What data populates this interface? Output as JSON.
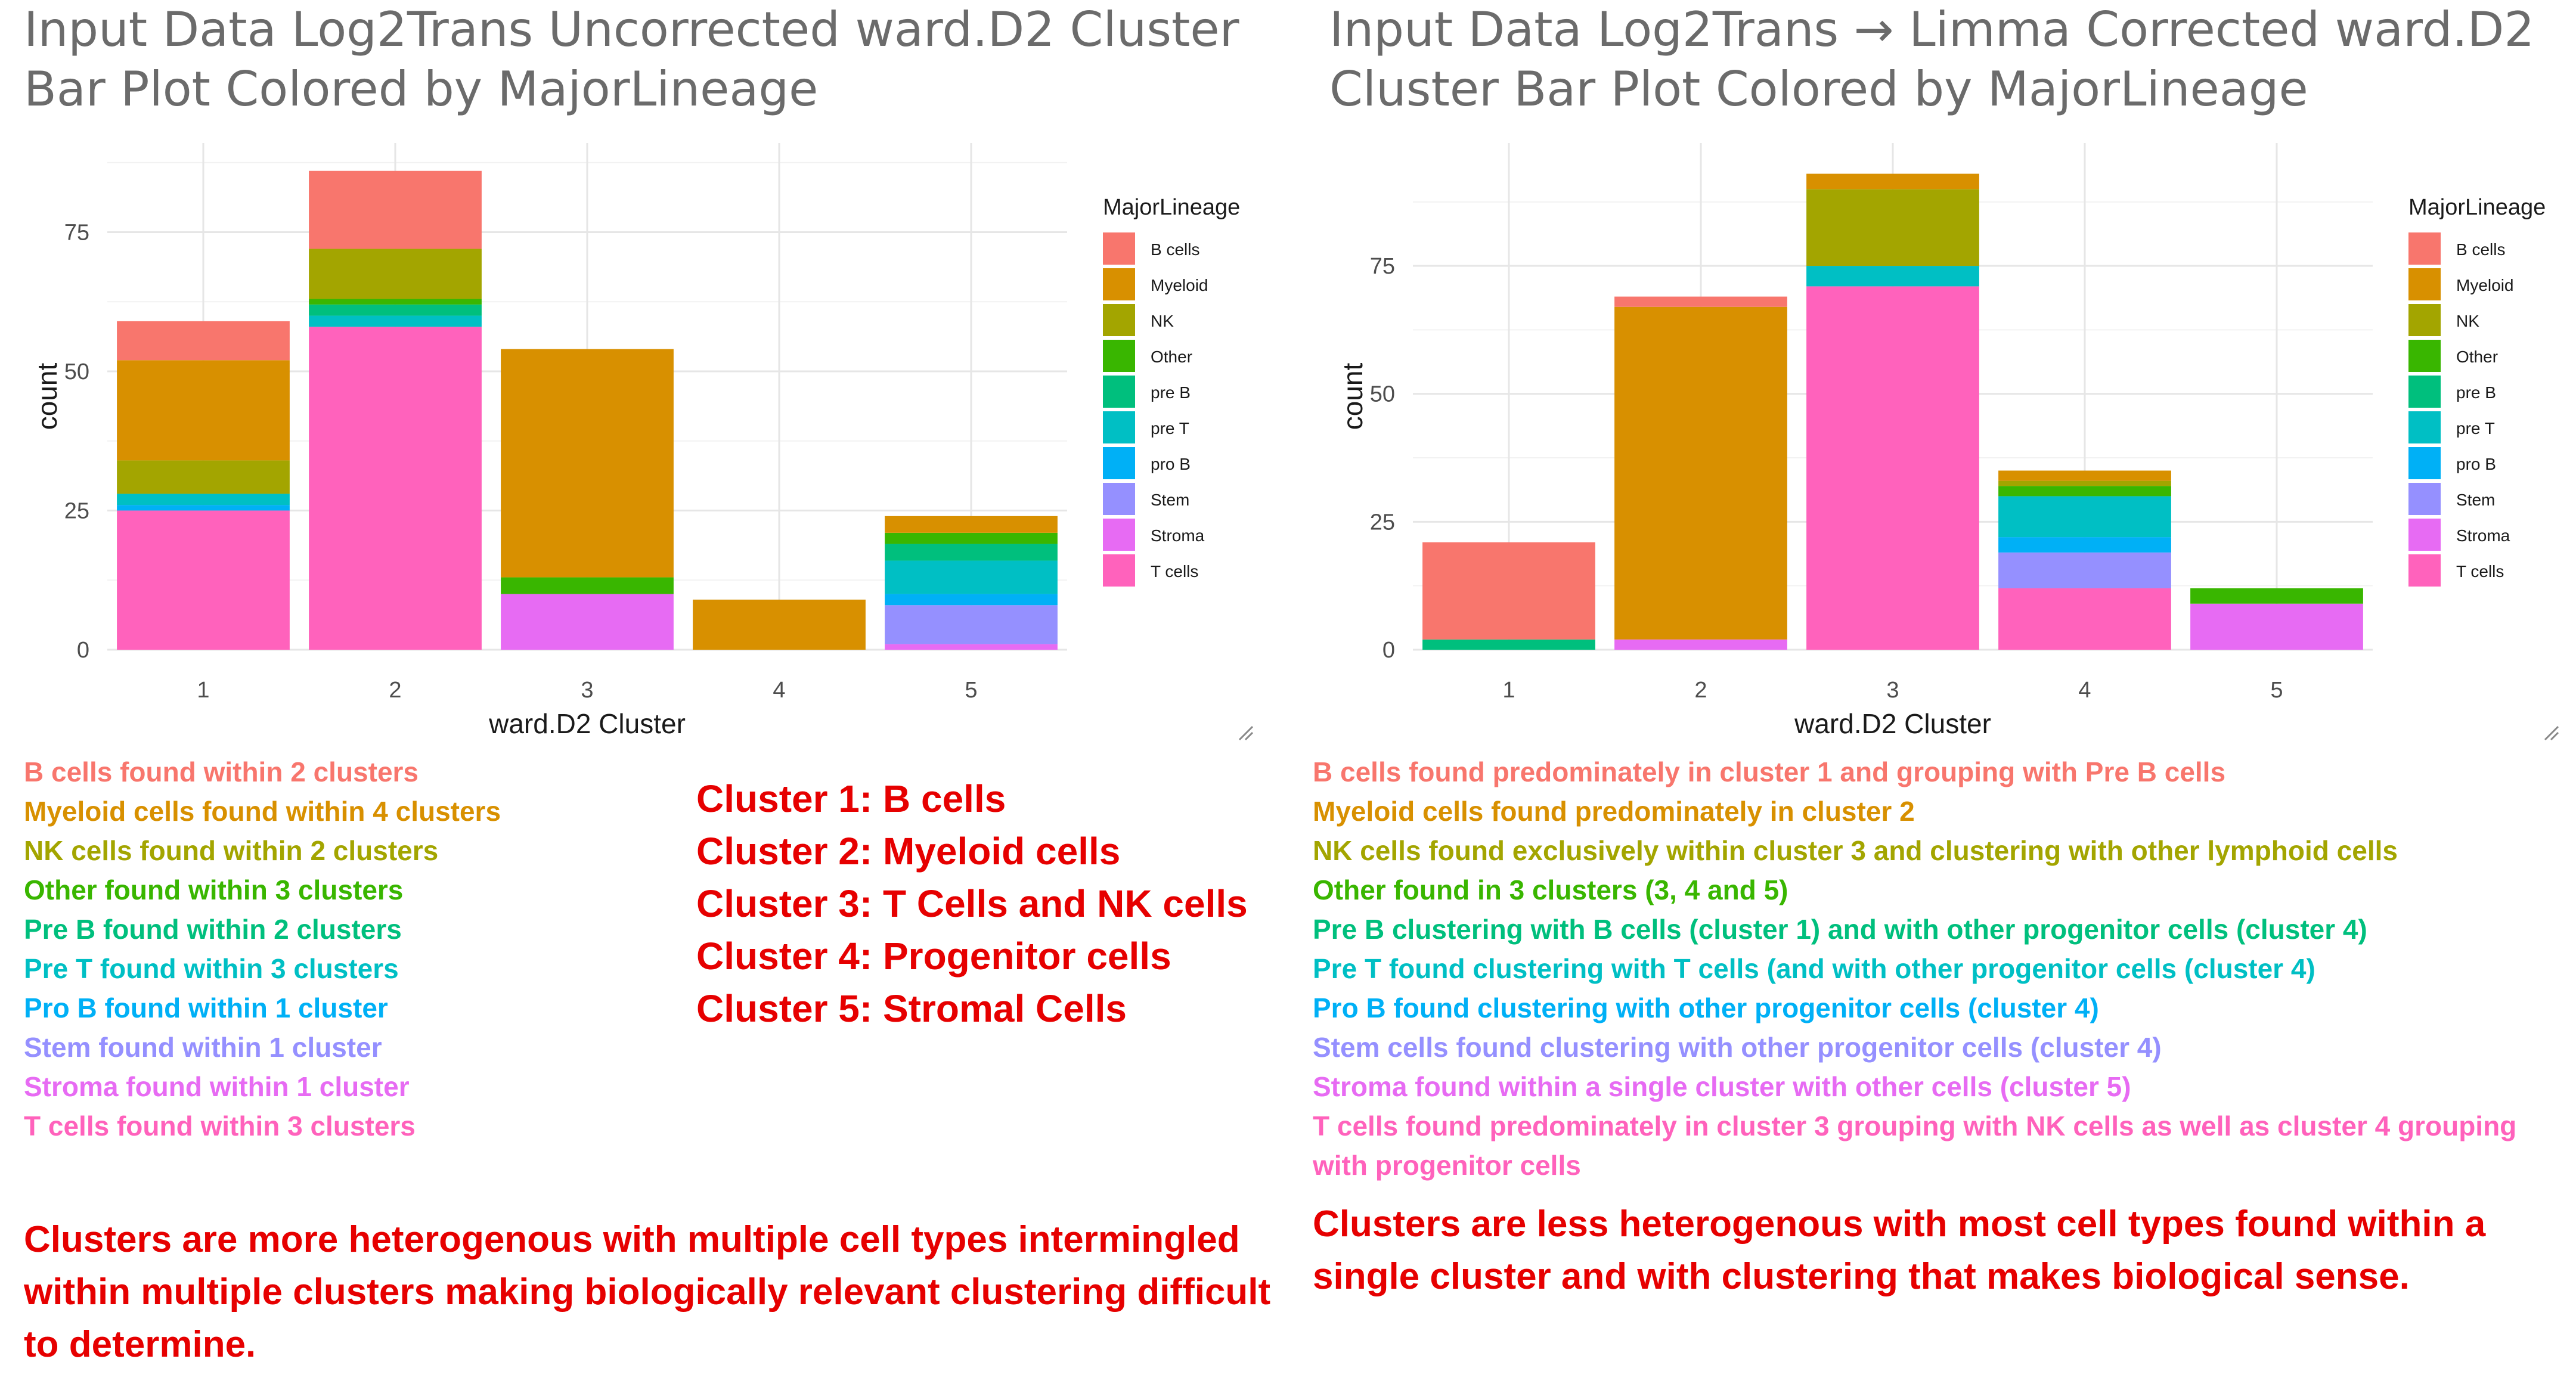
{
  "colors": {
    "B cells": "#F8766D",
    "Myeloid": "#D89000",
    "NK": "#A3A500",
    "Other": "#39B600",
    "pre B": "#00BF7D",
    "pre T": "#00BFC4",
    "pro B": "#00B0F6",
    "Stem": "#9590FF",
    "Stroma": "#E76BF3",
    "T cells": "#FF62BC",
    "title": "#6b6b6b",
    "summary": "#e60000"
  },
  "left": {
    "title": "Input Data Log2Trans Uncorrected ward.D2 Cluster Bar Plot Colored by MajorLineage",
    "notes": [
      {
        "text": "B cells found within 2 clusters",
        "lineage": "B cells"
      },
      {
        "text": "Myeloid cells found within 4 clusters",
        "lineage": "Myeloid"
      },
      {
        "text": "NK cells found within 2 clusters",
        "lineage": "NK"
      },
      {
        "text": "Other found within 3 clusters",
        "lineage": "Other"
      },
      {
        "text": "Pre B found within 2 clusters",
        "lineage": "pre B"
      },
      {
        "text": "Pre T found within 3 clusters",
        "lineage": "pre T"
      },
      {
        "text": "Pro B found within 1 cluster",
        "lineage": "pro B"
      },
      {
        "text": "Stem found within 1 cluster",
        "lineage": "Stem"
      },
      {
        "text": "Stroma found within 1 cluster",
        "lineage": "Stroma"
      },
      {
        "text": "T cells found within 3 clusters",
        "lineage": "T cells"
      }
    ],
    "summary": [
      "Cluster 1: B cells",
      "Cluster 2: Myeloid cells",
      "Cluster 3: T Cells and NK cells",
      "Cluster 4: Progenitor cells",
      "Cluster 5: Stromal Cells"
    ],
    "conclusion": "Clusters are more heterogenous with multiple cell types intermingled within multiple clusters making biologically relevant clustering difficult to determine."
  },
  "right": {
    "title": "Input Data Log2Trans → Limma Corrected ward.D2 Cluster Bar Plot Colored by MajorLineage",
    "notes": [
      {
        "text": "B cells found predominately in cluster 1 and grouping with Pre B cells",
        "lineage": "B cells"
      },
      {
        "text": "Myeloid cells found predominately in cluster 2",
        "lineage": "Myeloid"
      },
      {
        "text": "NK cells found exclusively within cluster 3 and clustering with other lymphoid cells",
        "lineage": "NK"
      },
      {
        "text": "Other found in 3 clusters (3, 4 and 5)",
        "lineage": "Other"
      },
      {
        "text": "Pre B clustering with B cells (cluster 1) and with other progenitor cells (cluster 4)",
        "lineage": "pre B"
      },
      {
        "text": "Pre T found clustering with T cells (and with other progenitor cells (cluster 4)",
        "lineage": "pre T"
      },
      {
        "text": "Pro B found clustering with other progenitor cells (cluster 4)",
        "lineage": "pro B"
      },
      {
        "text": "Stem cells found clustering with other progenitor cells (cluster 4)",
        "lineage": "Stem"
      },
      {
        "text": "Stroma found within a single cluster with other cells (cluster 5)",
        "lineage": "Stroma"
      },
      {
        "text": "T cells found predominately in cluster 3 grouping with NK cells as well as cluster 4 grouping with progenitor cells",
        "lineage": "T cells"
      }
    ],
    "conclusion": "Clusters are less heterogenous with most cell types found within a single cluster and with clustering that makes biological sense."
  },
  "chart_data": [
    {
      "type": "bar",
      "stacked": true,
      "xlabel": "ward.D2 Cluster",
      "ylabel": "count",
      "legend_title": "MajorLineage",
      "legend_labels": [
        "B cells",
        "Myeloid",
        "NK",
        "Other",
        "pre B",
        "pre T",
        "pro B",
        "Stem",
        "Stroma",
        "T cells"
      ],
      "legend_position": "right",
      "grid": true,
      "categories": [
        "1",
        "2",
        "3",
        "4",
        "5"
      ],
      "yticks": [
        0,
        25,
        50,
        75
      ],
      "ylim": [
        0,
        91
      ],
      "series": [
        {
          "name": "B cells",
          "values": [
            7,
            14,
            0,
            0,
            0
          ]
        },
        {
          "name": "Myeloid",
          "values": [
            18,
            0,
            41,
            9,
            3
          ]
        },
        {
          "name": "NK",
          "values": [
            6,
            9,
            0,
            0,
            0
          ]
        },
        {
          "name": "Other",
          "values": [
            0,
            1,
            3,
            0,
            2
          ]
        },
        {
          "name": "pre B",
          "values": [
            0,
            2,
            0,
            0,
            3
          ]
        },
        {
          "name": "pre T",
          "values": [
            2,
            2,
            0,
            0,
            6
          ]
        },
        {
          "name": "pro B",
          "values": [
            1,
            0,
            0,
            0,
            2
          ]
        },
        {
          "name": "Stem",
          "values": [
            0,
            0,
            0,
            0,
            7
          ]
        },
        {
          "name": "Stroma",
          "values": [
            0,
            0,
            10,
            0,
            1
          ]
        },
        {
          "name": "T cells",
          "values": [
            25,
            58,
            0,
            0,
            0
          ]
        }
      ]
    },
    {
      "type": "bar",
      "stacked": true,
      "xlabel": "ward.D2 Cluster",
      "ylabel": "count",
      "legend_title": "MajorLineage",
      "legend_labels": [
        "B cells",
        "Myeloid",
        "NK",
        "Other",
        "pre B",
        "pre T",
        "pro B",
        "Stem",
        "Stroma",
        "T cells"
      ],
      "legend_position": "right",
      "grid": true,
      "categories": [
        "1",
        "2",
        "3",
        "4",
        "5"
      ],
      "yticks": [
        0,
        25,
        50,
        75
      ],
      "ylim": [
        0,
        99
      ],
      "series": [
        {
          "name": "B cells",
          "values": [
            19,
            2,
            0,
            0,
            0
          ]
        },
        {
          "name": "Myeloid",
          "values": [
            0,
            65,
            3,
            2,
            0
          ]
        },
        {
          "name": "NK",
          "values": [
            0,
            0,
            15,
            1,
            0
          ]
        },
        {
          "name": "Other",
          "values": [
            0,
            0,
            0,
            2,
            3
          ]
        },
        {
          "name": "pre B",
          "values": [
            2,
            0,
            0,
            0,
            0
          ]
        },
        {
          "name": "pre T",
          "values": [
            0,
            0,
            4,
            8,
            0
          ]
        },
        {
          "name": "pro B",
          "values": [
            0,
            0,
            0,
            3,
            0
          ]
        },
        {
          "name": "Stem",
          "values": [
            0,
            0,
            0,
            7,
            0
          ]
        },
        {
          "name": "Stroma",
          "values": [
            0,
            2,
            0,
            0,
            9
          ]
        },
        {
          "name": "T cells",
          "values": [
            0,
            0,
            71,
            12,
            0
          ]
        }
      ]
    }
  ]
}
